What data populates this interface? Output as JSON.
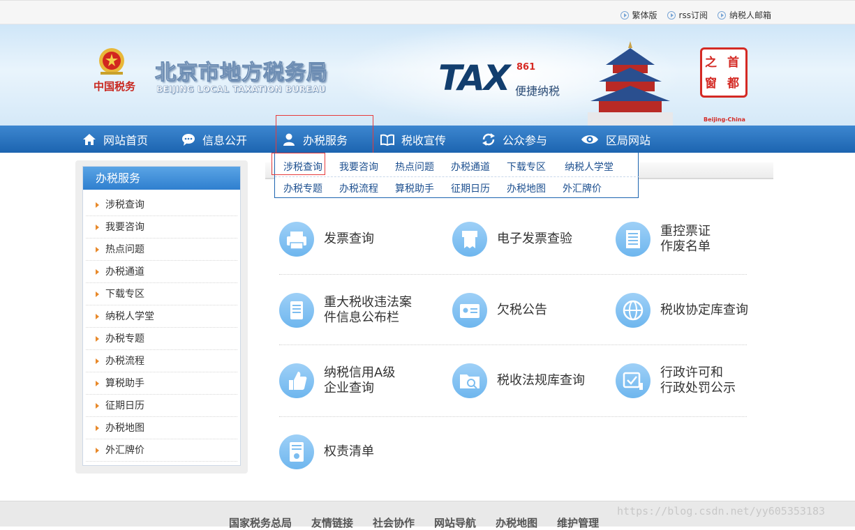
{
  "topbar": {
    "links": [
      "繁体版",
      "rss订阅",
      "纳税人邮箱"
    ]
  },
  "banner": {
    "emblem_text": "中国税务",
    "site_name_cn": "北京市地方税务局",
    "site_name_en": "BEIJING LOCAL TAXATION BUREAU",
    "tax_logo": "TAX",
    "tax_number": "861",
    "tax_slogan": "便捷纳税",
    "seal_chars": [
      "之",
      "首",
      "窗",
      "都"
    ],
    "seal_caption": "Beijing-China"
  },
  "nav": {
    "items": [
      {
        "label": "网站首页",
        "icon": "home-icon"
      },
      {
        "label": "信息公开",
        "icon": "chat-icon"
      },
      {
        "label": "办税服务",
        "icon": "user-icon"
      },
      {
        "label": "税收宣传",
        "icon": "book-icon"
      },
      {
        "label": "公众参与",
        "icon": "refresh-icon"
      },
      {
        "label": "区局网站",
        "icon": "eye-icon"
      }
    ],
    "active": "办税服务"
  },
  "dropdown": {
    "row1": [
      "涉税查询",
      "我要咨询",
      "热点问题",
      "办税通道",
      "下载专区",
      "纳税人学堂"
    ],
    "row2": [
      "办税专题",
      "办税流程",
      "算税助手",
      "征期日历",
      "办税地图",
      "外汇牌价"
    ],
    "selected": "涉税查询"
  },
  "sidebar": {
    "title": "办税服务",
    "items": [
      "涉税查询",
      "我要咨询",
      "热点问题",
      "办税通道",
      "下载专区",
      "纳税人学堂",
      "办税专题",
      "办税流程",
      "算税助手",
      "征期日历",
      "办税地图",
      "外汇牌价"
    ]
  },
  "services": [
    {
      "label": "发票查询",
      "icon": "printer-icon"
    },
    {
      "label": "电子发票查验",
      "icon": "receipt-icon"
    },
    {
      "label": "重控票证\n作废名单",
      "icon": "list-icon"
    },
    {
      "label": "重大税收违法案\n件信息公布栏",
      "icon": "document-icon"
    },
    {
      "label": "欠税公告",
      "icon": "id-card-icon"
    },
    {
      "label": "税收协定库查询",
      "icon": "globe-icon"
    },
    {
      "label": "纳税信用A级\n企业查询",
      "icon": "thumbs-up-icon"
    },
    {
      "label": "税收法规库查询",
      "icon": "folder-search-icon"
    },
    {
      "label": "行政许可和\n行政处罚公示",
      "icon": "checkbox-icon"
    },
    {
      "label": "权责清单",
      "icon": "certificate-icon"
    }
  ],
  "footer": {
    "links": [
      "国家税务总局",
      "友情链接",
      "社会协作",
      "网站导航",
      "办税地图",
      "维护管理"
    ]
  },
  "watermark": "https://blog.csdn.net/yy605353183"
}
